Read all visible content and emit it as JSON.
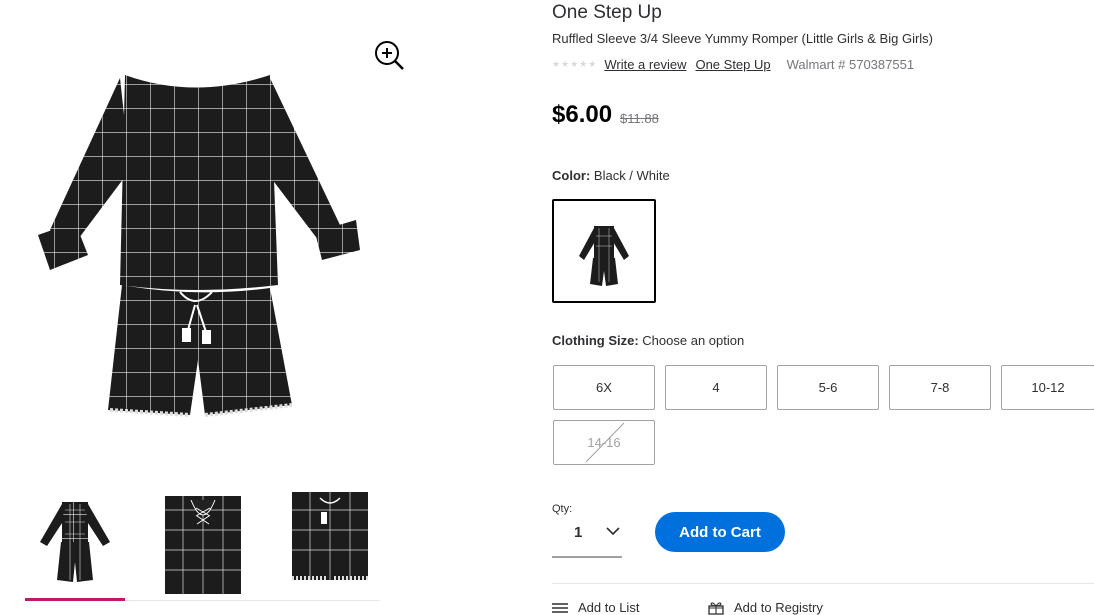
{
  "brand": "One Step Up",
  "product_name": "Ruffled Sleeve 3/4 Sleeve Yummy Romper (Little Girls & Big Girls)",
  "rating": {
    "stars": 0,
    "write_review": "Write a review",
    "brand_link": "One Step Up",
    "walmart_number": "Walmart # 570387551"
  },
  "price": {
    "current": "$6.00",
    "was": "$11.88"
  },
  "color": {
    "label": "Color:",
    "value": "Black / White"
  },
  "size": {
    "label": "Clothing Size:",
    "value": "Choose an option",
    "options": [
      "6X",
      "4",
      "5-6",
      "7-8",
      "10-12",
      "14-16"
    ],
    "unavailable": [
      "14-16"
    ]
  },
  "qty": {
    "label": "Qty:",
    "value": "1"
  },
  "add_to_cart": "Add to Cart",
  "actions": {
    "add_to_list": "Add to List",
    "add_to_registry": "Add to Registry"
  },
  "icons": {
    "zoom": "zoom-in-icon",
    "chevron": "chevron-down-icon",
    "list": "list-icon",
    "gift": "gift-icon"
  },
  "colors": {
    "accent": "#0071dc",
    "thumb_active": "#c3176a",
    "garment": "#1c1c1c"
  }
}
